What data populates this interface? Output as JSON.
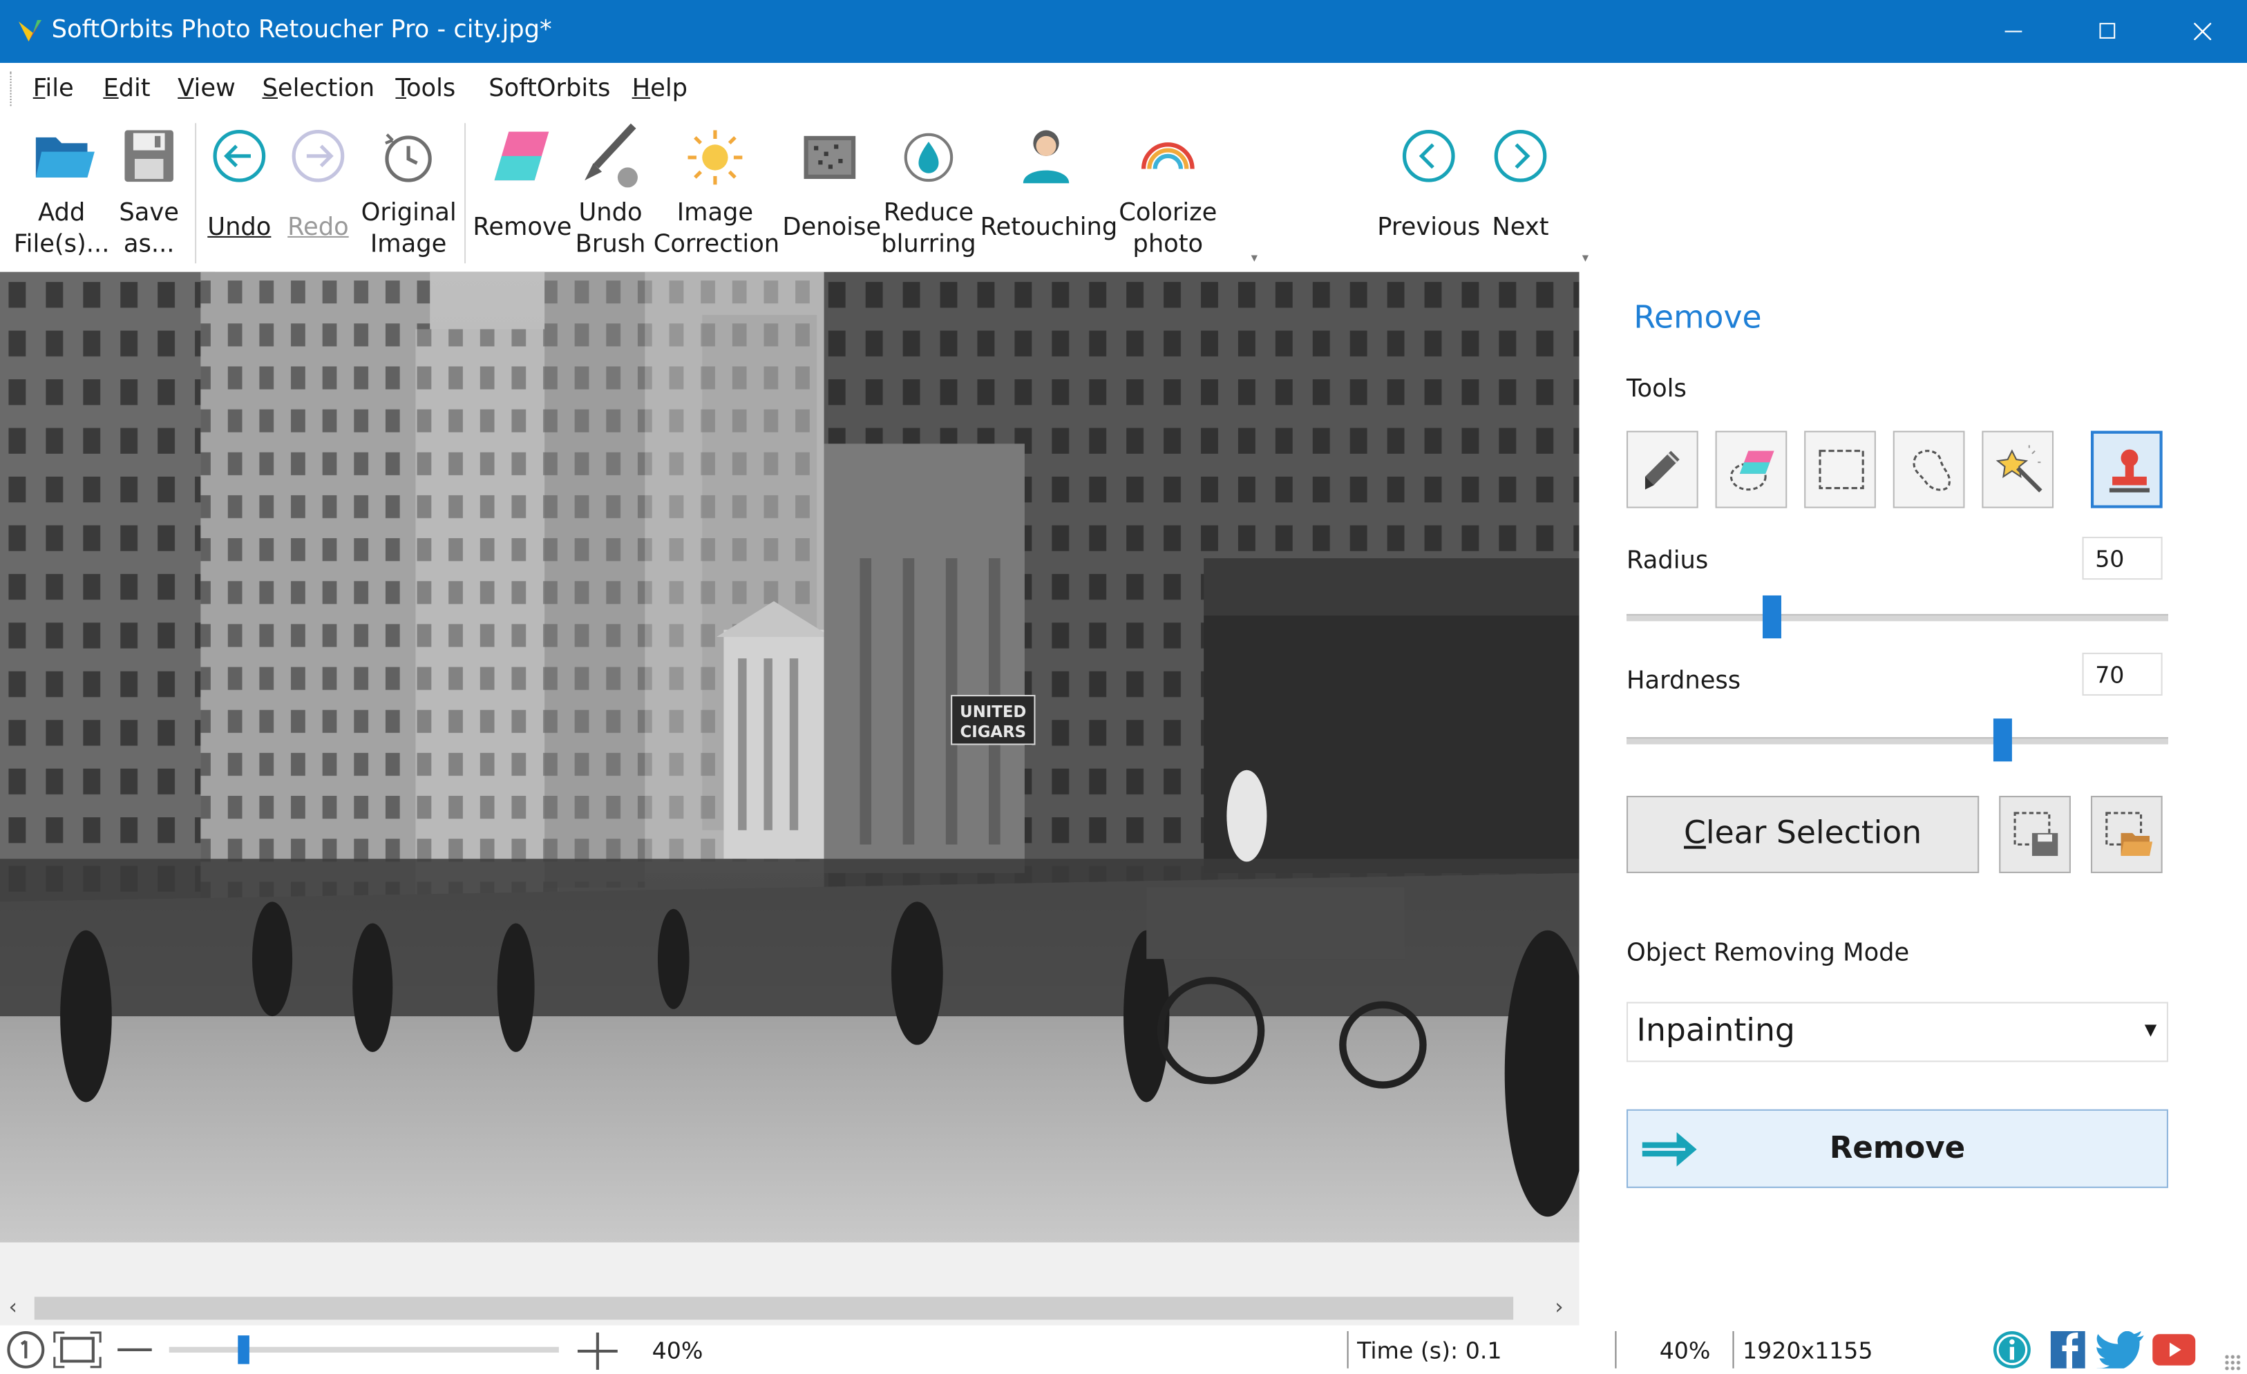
{
  "window": {
    "title": "SoftOrbits Photo Retoucher Pro - city.jpg*",
    "controls": [
      "minimize-icon",
      "maximize-icon",
      "close-icon"
    ]
  },
  "menu": [
    {
      "label": "File",
      "hotkey": "F"
    },
    {
      "label": "Edit",
      "hotkey": "E"
    },
    {
      "label": "View",
      "hotkey": "V"
    },
    {
      "label": "Selection",
      "hotkey": "S"
    },
    {
      "label": "Tools",
      "hotkey": "T"
    },
    {
      "label": "SoftOrbits",
      "hotkey": ""
    },
    {
      "label": "Help",
      "hotkey": "H"
    }
  ],
  "toolbar": {
    "add_files": "Add\nFile(s)...",
    "save_as": "Save\nas...",
    "undo": "Undo",
    "redo": "Redo",
    "original_image": "Original\nImage",
    "remove": "Remove",
    "undo_brush": "Undo\nBrush",
    "image_correction": "Image\nCorrection",
    "denoise": "Denoise",
    "reduce_blurring": "Reduce\nblurring",
    "retouching": "Retouching",
    "colorize_photo": "Colorize\nphoto",
    "previous": "Previous",
    "next": "Next"
  },
  "photo": {
    "sign_text": "UNITED\nCIGARS"
  },
  "panel": {
    "title": "Remove",
    "tools_label": "Tools",
    "tools": [
      {
        "name": "pencil-icon",
        "active": false
      },
      {
        "name": "eraser-icon",
        "active": false
      },
      {
        "name": "rectangle-select-icon",
        "active": false
      },
      {
        "name": "lasso-icon",
        "active": false
      },
      {
        "name": "magic-wand-icon",
        "active": false
      },
      {
        "name": "stamp-icon",
        "active": true
      }
    ],
    "radius_label": "Radius",
    "radius_value": "50",
    "radius_level": 0.26,
    "hardness_label": "Hardness",
    "hardness_value": "70",
    "hardness_level": 0.7,
    "clear_selection": "Clear Selection",
    "mode_label": "Object Removing Mode",
    "mode_value": "Inpainting",
    "remove_button": "Remove"
  },
  "status": {
    "zoom_slider_text": "40%",
    "zoom_level": 0.18,
    "time": "Time (s): 0.1",
    "zoom": "40%",
    "dimensions": "1920x1155"
  },
  "colors": {
    "titlebar": "#0a72c4",
    "accent": "#1e7fd6",
    "teal_icon": "#18a3b8"
  }
}
